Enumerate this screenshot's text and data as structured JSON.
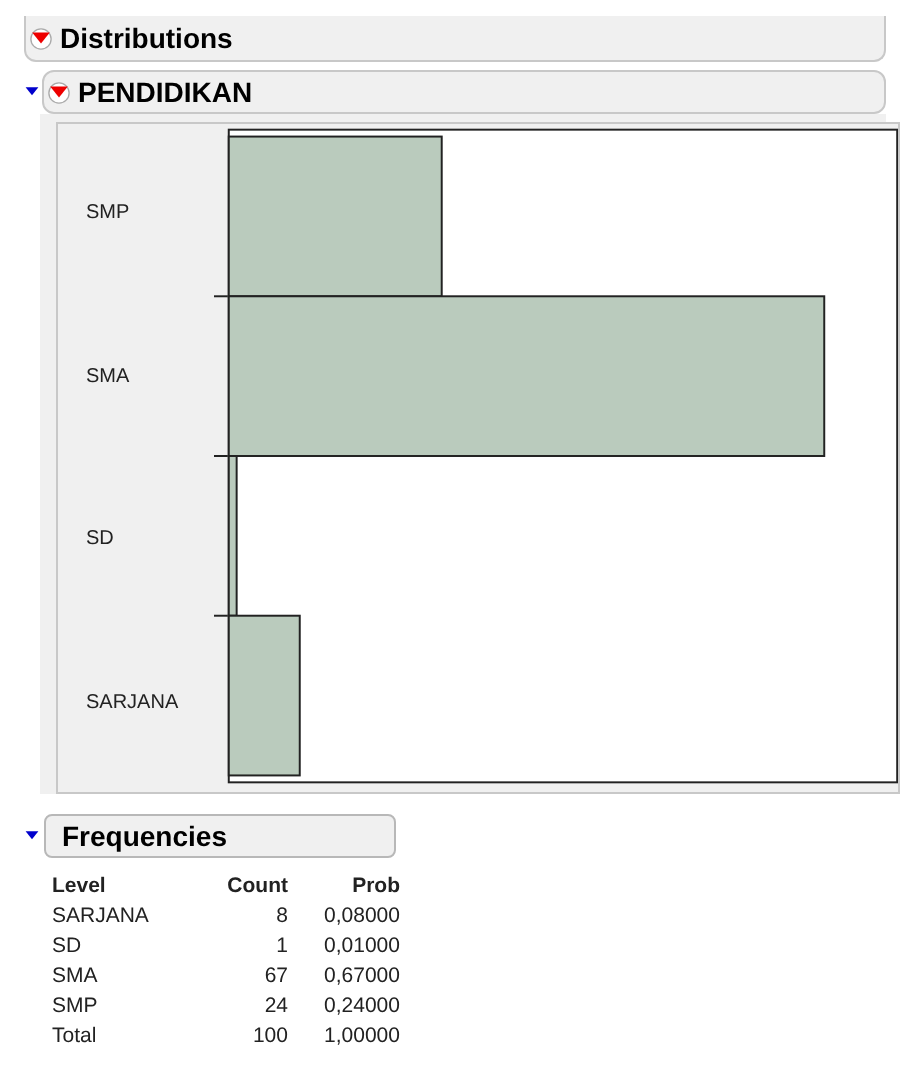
{
  "outline": {
    "title": "Distributions",
    "expanded": true
  },
  "variable": {
    "title": "PENDIDIKAN",
    "expanded": true,
    "bar_labels": [
      "SMP",
      "SMA",
      "SD",
      "SARJANA"
    ]
  },
  "frequencies": {
    "title": "Frequencies",
    "expanded": true,
    "columns": [
      "Level",
      "Count",
      "Prob"
    ],
    "rows": [
      [
        "SARJANA",
        "8",
        "0,08000"
      ],
      [
        "SD",
        "1",
        "0,01000"
      ],
      [
        "SMA",
        "67",
        "0,67000"
      ],
      [
        "SMP",
        "24",
        "0,24000"
      ],
      [
        "Total",
        "100",
        "1,00000"
      ]
    ]
  }
}
